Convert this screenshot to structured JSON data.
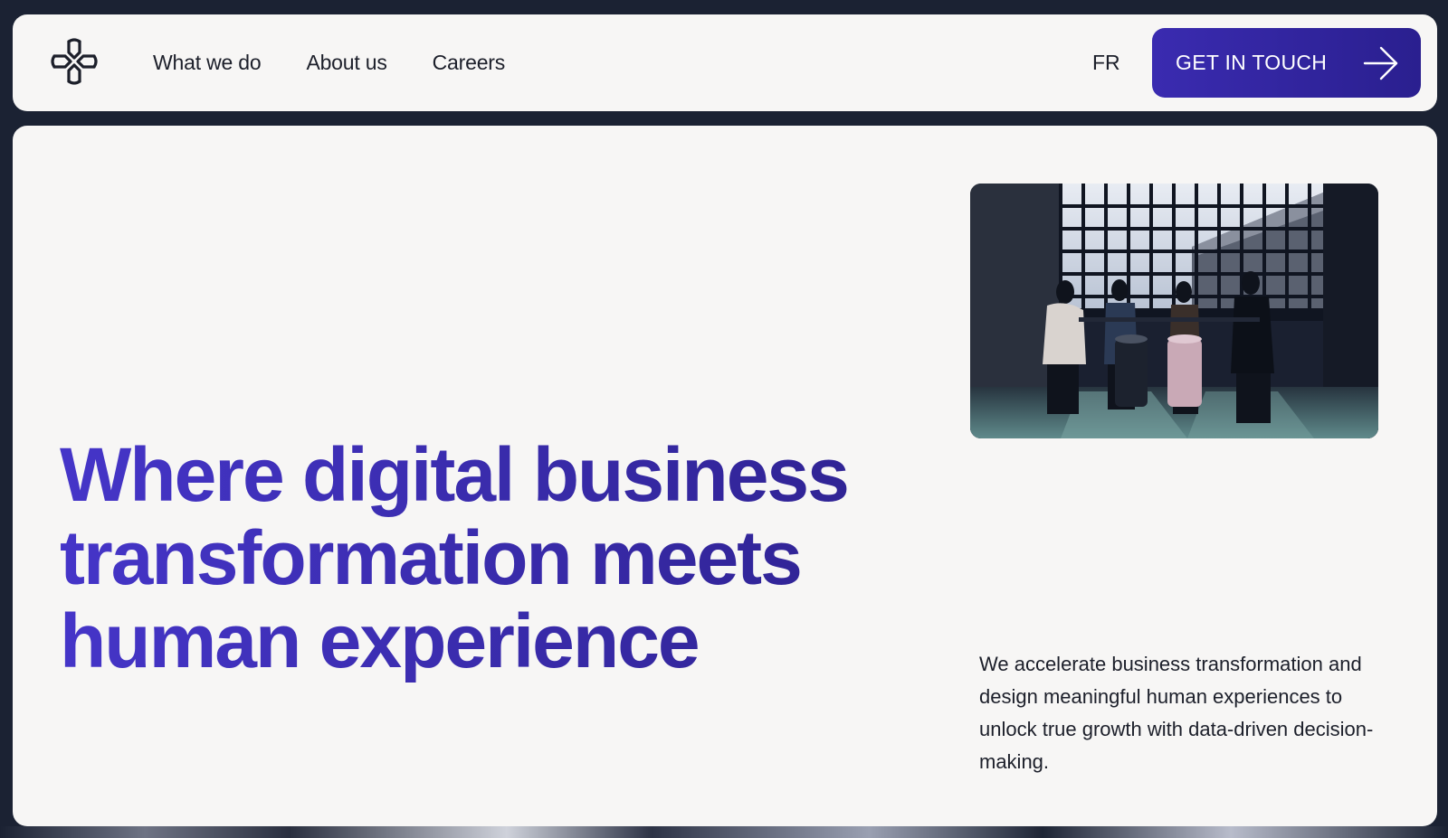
{
  "header": {
    "logo_icon": "asterisk-logo-icon",
    "nav": [
      {
        "label": "What we do"
      },
      {
        "label": "About us"
      },
      {
        "label": "Careers"
      }
    ],
    "language": "FR",
    "cta": {
      "label": "GET IN TOUCH",
      "icon": "arrow-right-icon"
    }
  },
  "hero": {
    "headline": "Where digital business transformation meets human experience",
    "description": "We accelerate business transformation and design meaningful human experiences to unlock true growth with data-driven decision-making.",
    "image": "team-meeting-by-window-photo"
  },
  "colors": {
    "accent": "#3b2fb5",
    "button": "#2f2399",
    "background": "#f7f6f5",
    "frame": "#1b2233"
  }
}
